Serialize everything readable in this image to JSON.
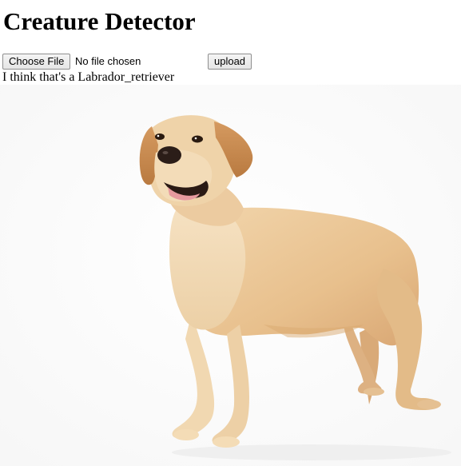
{
  "page": {
    "title": "Creature Detector"
  },
  "upload_form": {
    "choose_file_label": "Choose File",
    "file_status": "No file chosen",
    "upload_label": "upload"
  },
  "result": {
    "text": "I think that's a Labrador_retriever"
  },
  "image": {
    "subject": "dog photo"
  }
}
